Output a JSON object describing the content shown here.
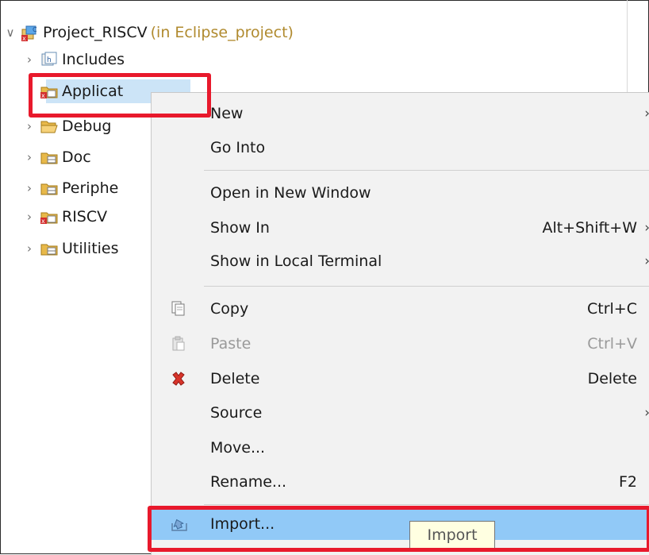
{
  "tree": {
    "project": {
      "name": "Project_RISCV",
      "suffix": "(in Eclipse_project)"
    },
    "items": [
      {
        "label": "Includes",
        "icon": "includes-icon"
      },
      {
        "label": "Applicat",
        "icon": "source-folder-error-icon"
      },
      {
        "label": "Debug",
        "icon": "open-folder-icon"
      },
      {
        "label": "Doc",
        "icon": "package-folder-icon"
      },
      {
        "label": "Periphe",
        "icon": "package-folder-icon"
      },
      {
        "label": "RISCV",
        "icon": "source-folder-error-icon"
      },
      {
        "label": "Utilities",
        "icon": "package-folder-icon"
      }
    ]
  },
  "menu": {
    "new": "New",
    "go_into": "Go Into",
    "open_new_window": "Open in New Window",
    "show_in": "Show In",
    "show_in_accel": "Alt+Shift+W",
    "show_local_terminal": "Show in Local Terminal",
    "copy": "Copy",
    "copy_accel": "Ctrl+C",
    "paste": "Paste",
    "paste_accel": "Ctrl+V",
    "delete": "Delete",
    "delete_accel": "Delete",
    "source": "Source",
    "move": "Move...",
    "rename": "Rename...",
    "rename_accel": "F2",
    "import": "Import..."
  },
  "tooltip": "Import",
  "colors": {
    "highlight": "#e8192c",
    "selection": "#cce4f7",
    "menu_hover": "#91c9f7",
    "menu_bg": "#f2f2f2"
  }
}
